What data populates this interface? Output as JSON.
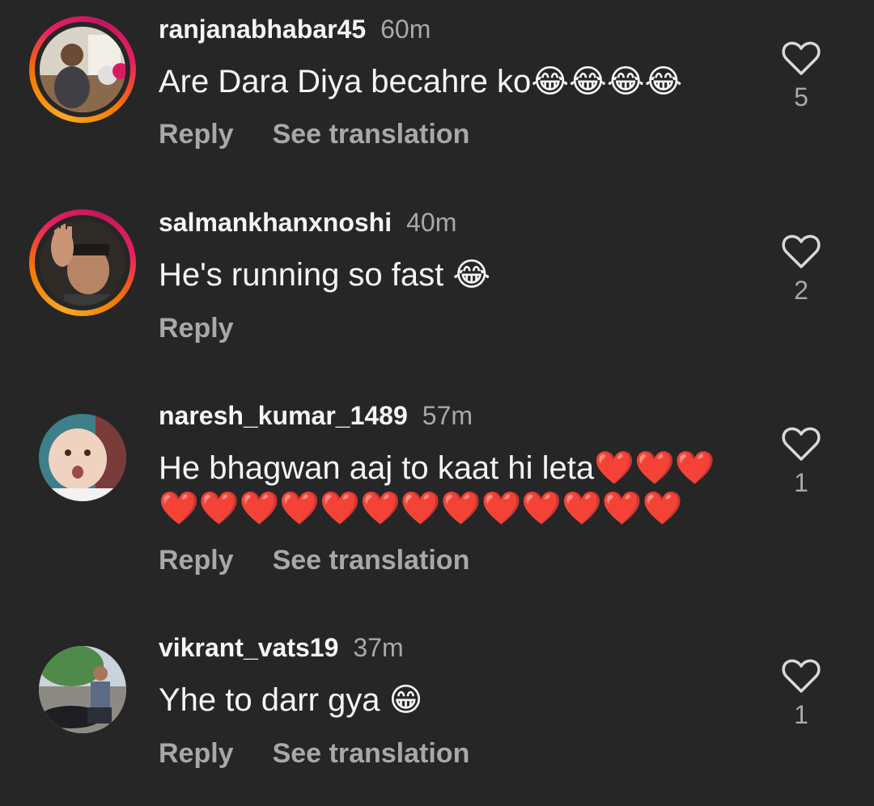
{
  "comments": [
    {
      "username": "ranjanabhabar45",
      "time": "60m",
      "text": "Are Dara Diya becahre ko😂😂😂😂",
      "reply_label": "Reply",
      "translate_label": "See translation",
      "likes": "5",
      "has_story": true,
      "avatar": "woman-photo"
    },
    {
      "username": "salmankhanxnoshi",
      "time": "40m",
      "text": "He's running so fast 😂",
      "reply_label": "Reply",
      "likes": "2",
      "has_story": true,
      "avatar": "man-waving-photo"
    },
    {
      "username": "naresh_kumar_1489",
      "time": "57m",
      "text": "He bhagwan aaj to kaat hi leta❤️❤️❤️❤️❤️❤️❤️❤️❤️❤️❤️❤️❤️❤️❤️❤️",
      "reply_label": "Reply",
      "translate_label": "See translation",
      "likes": "1",
      "has_story": false,
      "avatar": "baby-photo"
    },
    {
      "username": "vikrant_vats19",
      "time": "37m",
      "text": "Yhe to darr gya 😁",
      "reply_label": "Reply",
      "translate_label": "See translation",
      "likes": "1",
      "has_story": false,
      "avatar": "man-on-bike-photo"
    }
  ],
  "colors": {
    "background": "#262626",
    "primary_text": "#f5f5f5",
    "secondary_text": "#a8a8a8",
    "story_ring": "#e91e63"
  },
  "icons": {
    "like": "heart-outline-icon"
  }
}
